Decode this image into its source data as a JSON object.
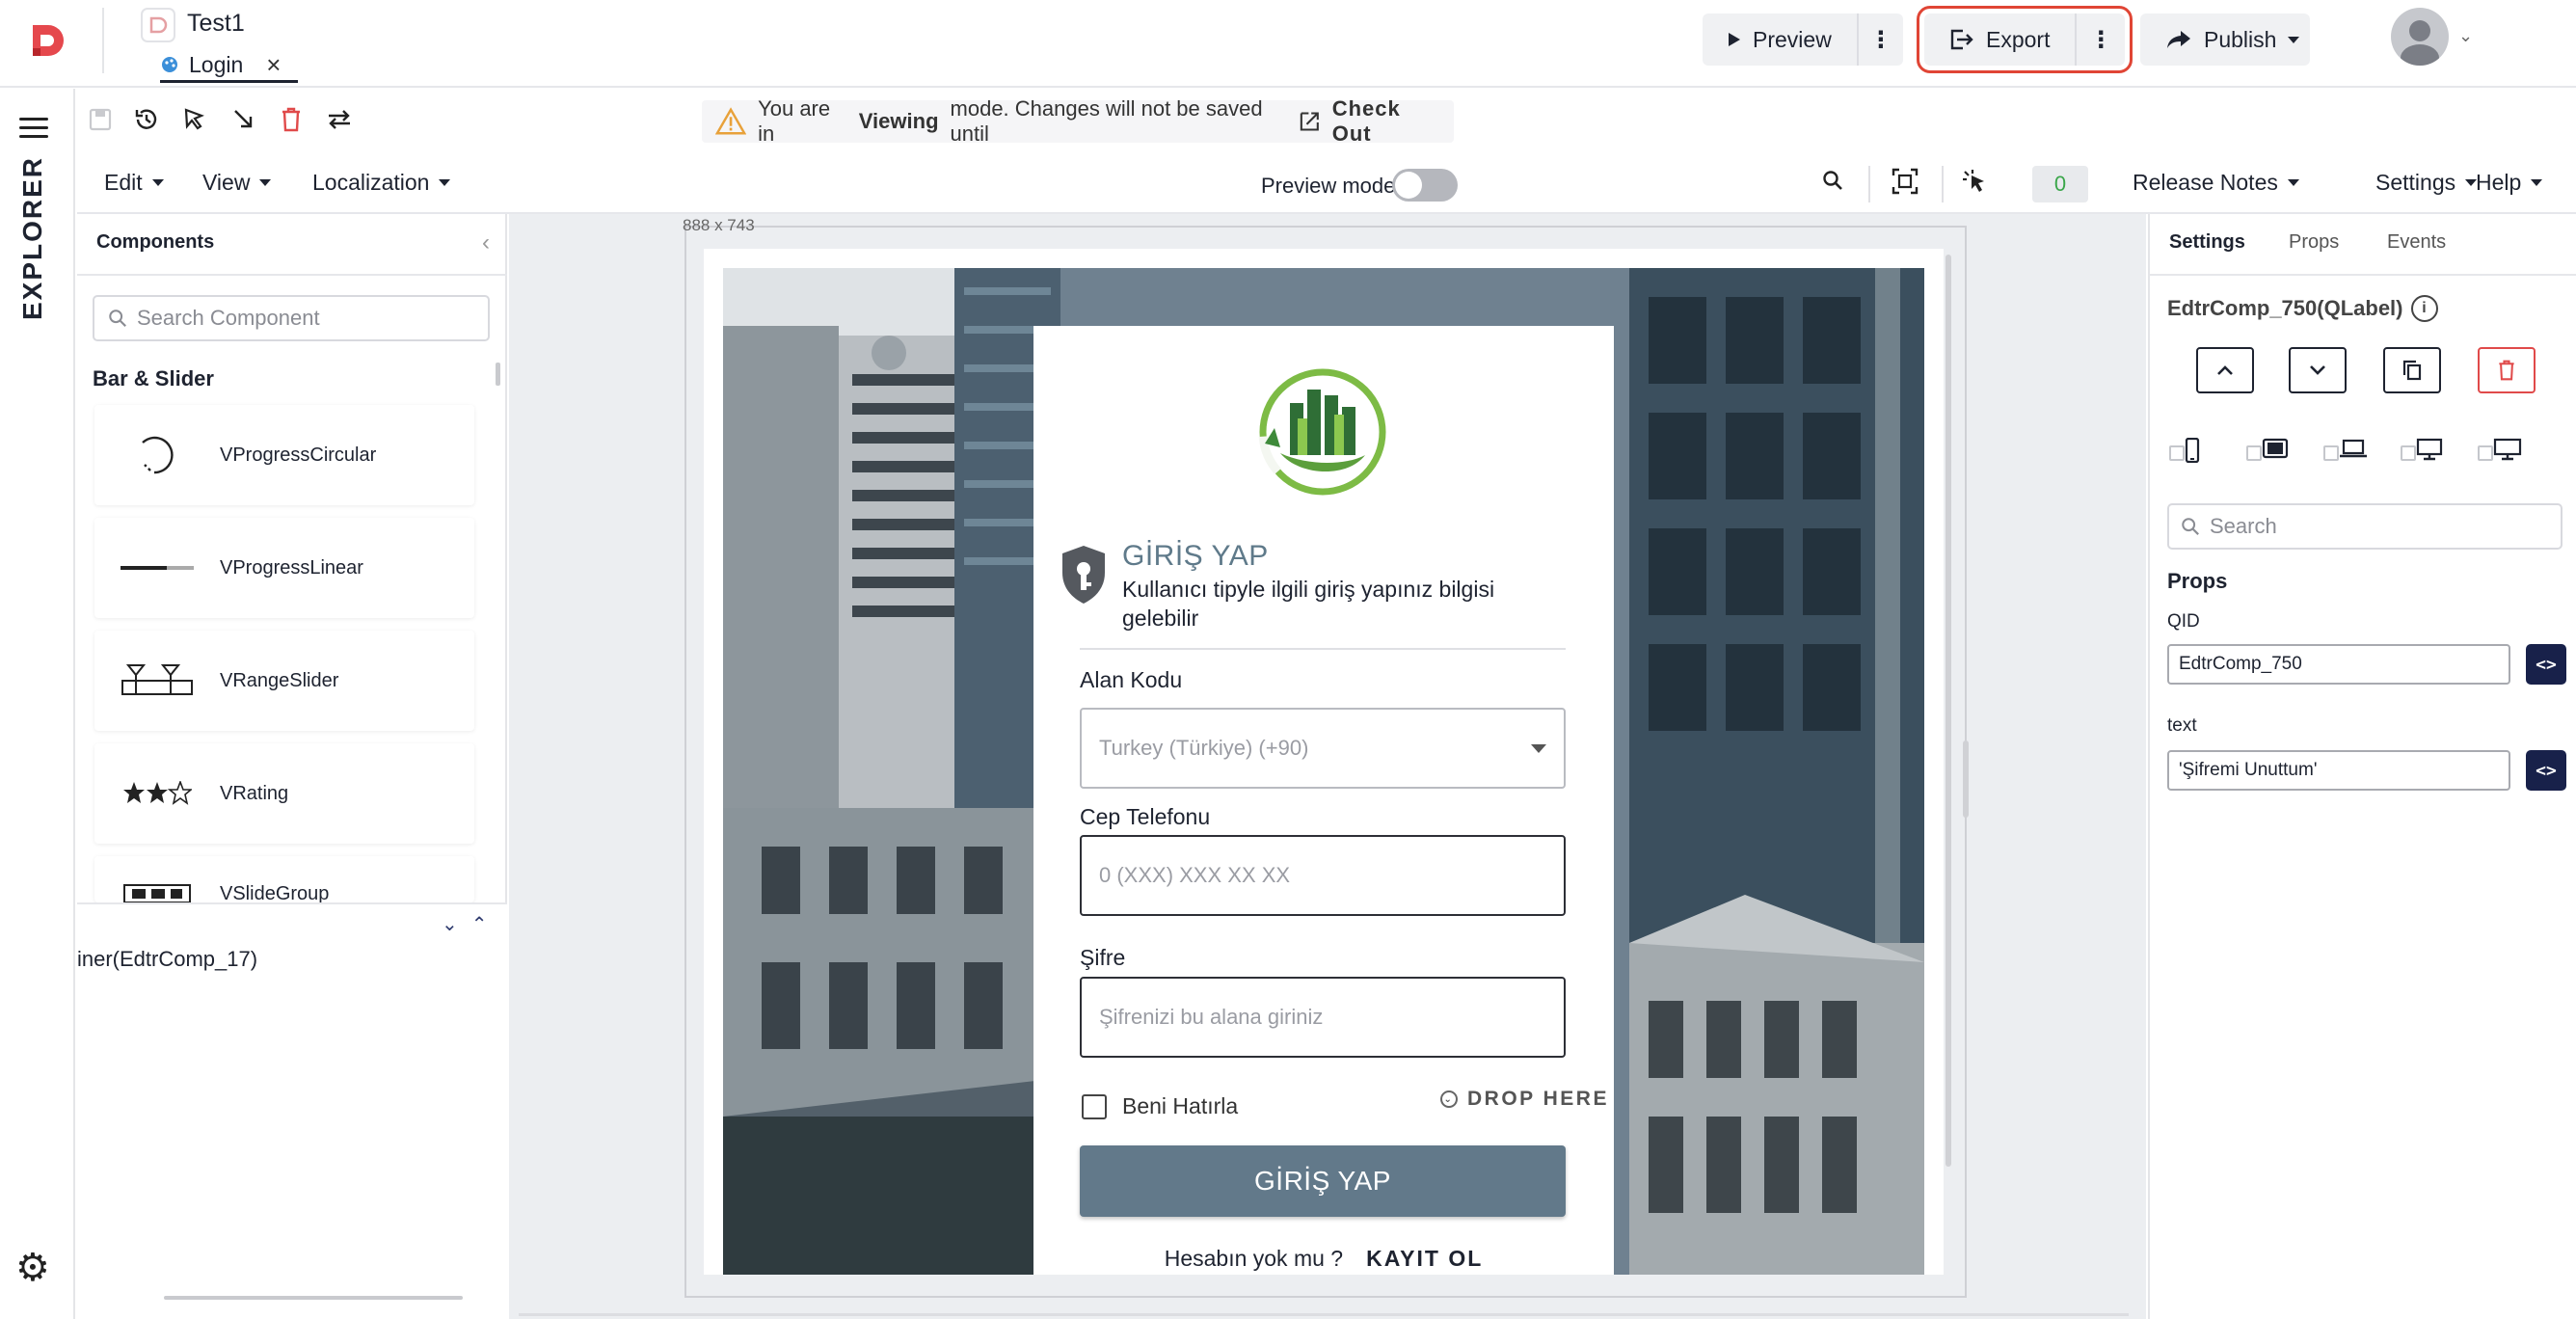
{
  "header": {
    "project_title": "Test1",
    "page_tab_label": "Login",
    "page_tab_close": "×",
    "preview_label": "Preview",
    "export_label": "Export",
    "publish_label": "Publish",
    "more_glyph": "⋮"
  },
  "banner": {
    "prefix": "You are in",
    "mode": "Viewing",
    "suffix": "mode. Changes will not be saved until",
    "link": "Check Out"
  },
  "menubar": {
    "items": [
      "Edit",
      "View",
      "Localization"
    ],
    "preview_mode_label": "Preview mode",
    "preview_mode_on": false,
    "counter": "0",
    "right_items": [
      "Release Notes",
      "Settings",
      "Help"
    ]
  },
  "rail": {
    "label": "EXPLORER"
  },
  "left_panel": {
    "title": "Components",
    "search_placeholder": "Search Component",
    "section": "Bar & Slider",
    "components": [
      {
        "name": "VProgressCircular",
        "icon": "progress-circular-icon"
      },
      {
        "name": "VProgressLinear",
        "icon": "progress-linear-icon"
      },
      {
        "name": "VRangeSlider",
        "icon": "range-slider-icon"
      },
      {
        "name": "VRating",
        "icon": "rating-icon"
      },
      {
        "name": "VSlideGroup",
        "icon": "slide-group-icon"
      }
    ],
    "tree_item": "iner(EdtrComp_17)"
  },
  "canvas": {
    "size_label": "888 x 743"
  },
  "login_form": {
    "heading": "GİRİŞ YAP",
    "subtitle": "Kullanıcı tipyle ilgili giriş yapınız bilgisi gelebilir",
    "area_code_label": "Alan Kodu",
    "area_code_value": "Turkey (Türkiye) (+90)",
    "phone_label": "Cep Telefonu",
    "phone_placeholder": "0 (XXX) XXX XX XX",
    "password_label": "Şifre",
    "password_placeholder": "Şifrenizi bu alana giriniz",
    "remember_label": "Beni Hatırla",
    "drop_here": "DROP HERE",
    "submit_label": "GİRİŞ YAP",
    "no_account_text": "Hesabın yok mu ?",
    "signup_label": "KAYIT OL"
  },
  "right_panel": {
    "tabs": [
      "Settings",
      "Props",
      "Events"
    ],
    "component_title": "EdtrComp_750(QLabel)",
    "search_placeholder": "Search",
    "props_heading": "Props",
    "qid_label": "QID",
    "qid_value": "EdtrComp_750",
    "text_label": "text",
    "text_value": "'Şifremi Unuttum'",
    "code_glyph": "<>"
  },
  "colors": {
    "accent_red": "#e04535",
    "button_slate": "#62798a",
    "code_button": "#18214a",
    "counter_green": "#3aa64a"
  }
}
